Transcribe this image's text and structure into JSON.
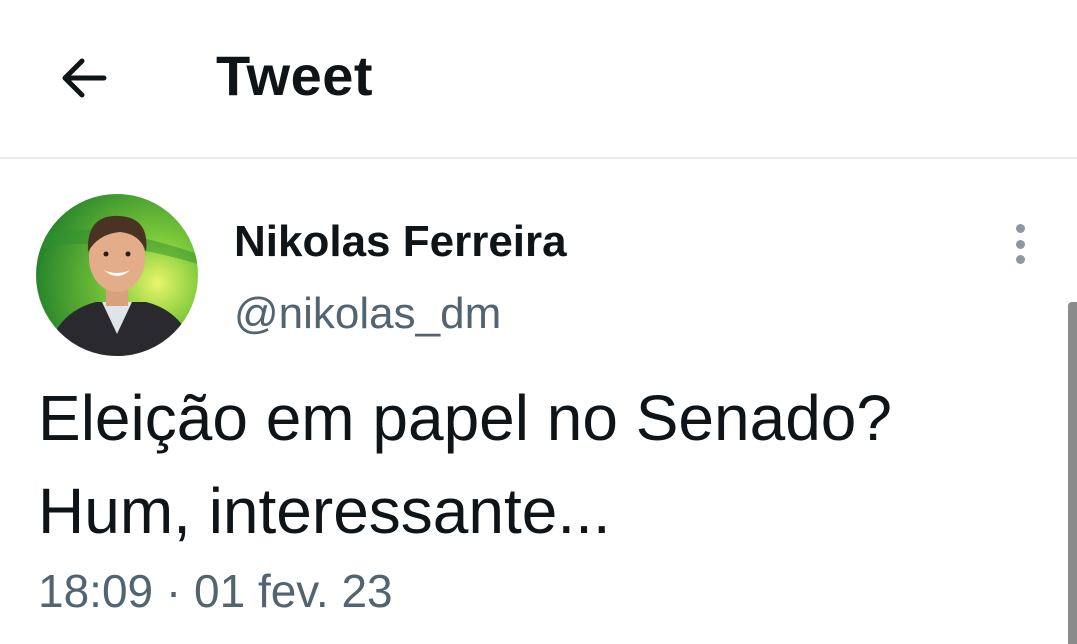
{
  "header": {
    "back_icon": "arrow-left-icon",
    "title": "Tweet"
  },
  "tweet": {
    "author": {
      "display_name": "Nikolas Ferreira",
      "handle": "@nikolas_dm",
      "avatar_icon": "profile-photo"
    },
    "more_icon": "vertical-ellipsis-icon",
    "text_lines": [
      "Eleição em papel no Senado?",
      "Hum, interessante..."
    ],
    "timestamp": "18:09 · 01 fev. 23"
  },
  "colors": {
    "text_primary": "#0f1419",
    "text_secondary": "#536471",
    "divider": "#e7e9ea",
    "avatar_background": "#3aa12e"
  }
}
